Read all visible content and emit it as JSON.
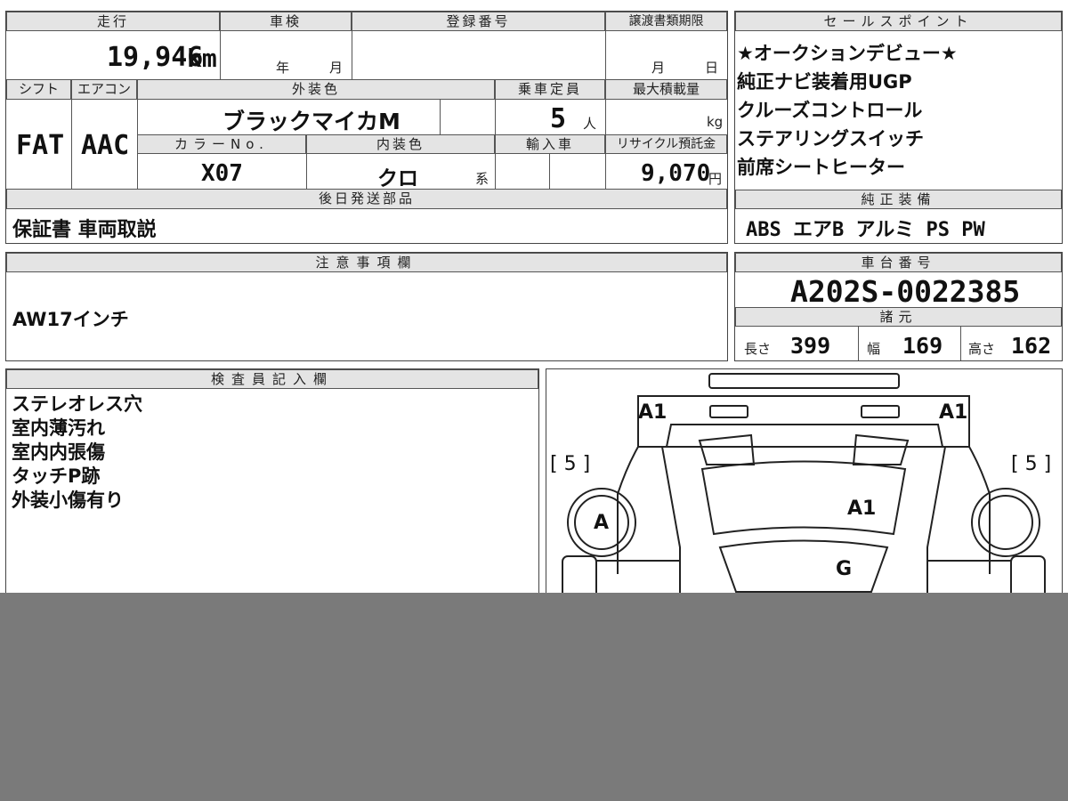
{
  "top_form": {
    "mileage_label": "走行",
    "mileage_value": "19,946",
    "mileage_unit": "km",
    "inspection_label": "車検",
    "inspection_year_unit": "年",
    "inspection_month_unit": "月",
    "registration_label": "登録番号",
    "transfer_label": "譲渡書類期限",
    "transfer_month_unit": "月",
    "transfer_day_unit": "日",
    "shift_label": "シフト",
    "shift_value": "FAT",
    "ac_label": "エアコン",
    "ac_value": "AAC",
    "exterior_label": "外装色",
    "exterior_value": "ブラックマイカM",
    "capacity_label": "乗車定員",
    "capacity_value": "5",
    "capacity_unit": "人",
    "max_load_label": "最大積載量",
    "max_load_unit": "kg",
    "color_no_label": "カラーNo.",
    "color_no_value": "X07",
    "interior_label": "内装色",
    "interior_value": "クロ",
    "interior_unit": "系",
    "import_label": "輸入車",
    "recycle_label": "リサイクル預託金",
    "recycle_value": "9,070",
    "recycle_unit": "円",
    "later_parts_label": "後日発送部品",
    "later_parts_value": "保証書 車両取説"
  },
  "sales_points": {
    "label": "セールスポイント",
    "items": [
      "★オークションデビュー★",
      "純正ナビ装着用UGP",
      "クルーズコントロール",
      "ステアリングスイッチ",
      "前席シートヒーター"
    ]
  },
  "standard_equipment": {
    "label": "純正装備",
    "value": "ABS エアB アルミ PS PW"
  },
  "notes": {
    "label": "注意事項欄",
    "value": "AW17インチ"
  },
  "chassis": {
    "label": "車台番号",
    "value": "A202S-0022385",
    "spec_label": "諸元",
    "length_label": "長さ",
    "length_value": "399",
    "width_label": "幅",
    "width_value": "169",
    "height_label": "高さ",
    "height_value": "162"
  },
  "inspector": {
    "label": "検査員記入欄",
    "items": [
      "ステレオレス穴",
      "室内薄汚れ",
      "室内内張傷",
      "タッチP跡",
      "外装小傷有り"
    ]
  },
  "diagram": {
    "mark_a1_left": "A1",
    "mark_a1_right": "A1",
    "mark_a1_hood": "A1",
    "mark_g": "G",
    "mark_a": "A",
    "tire_left": "[ 5 ]",
    "tire_right": "[ 5 ]"
  }
}
